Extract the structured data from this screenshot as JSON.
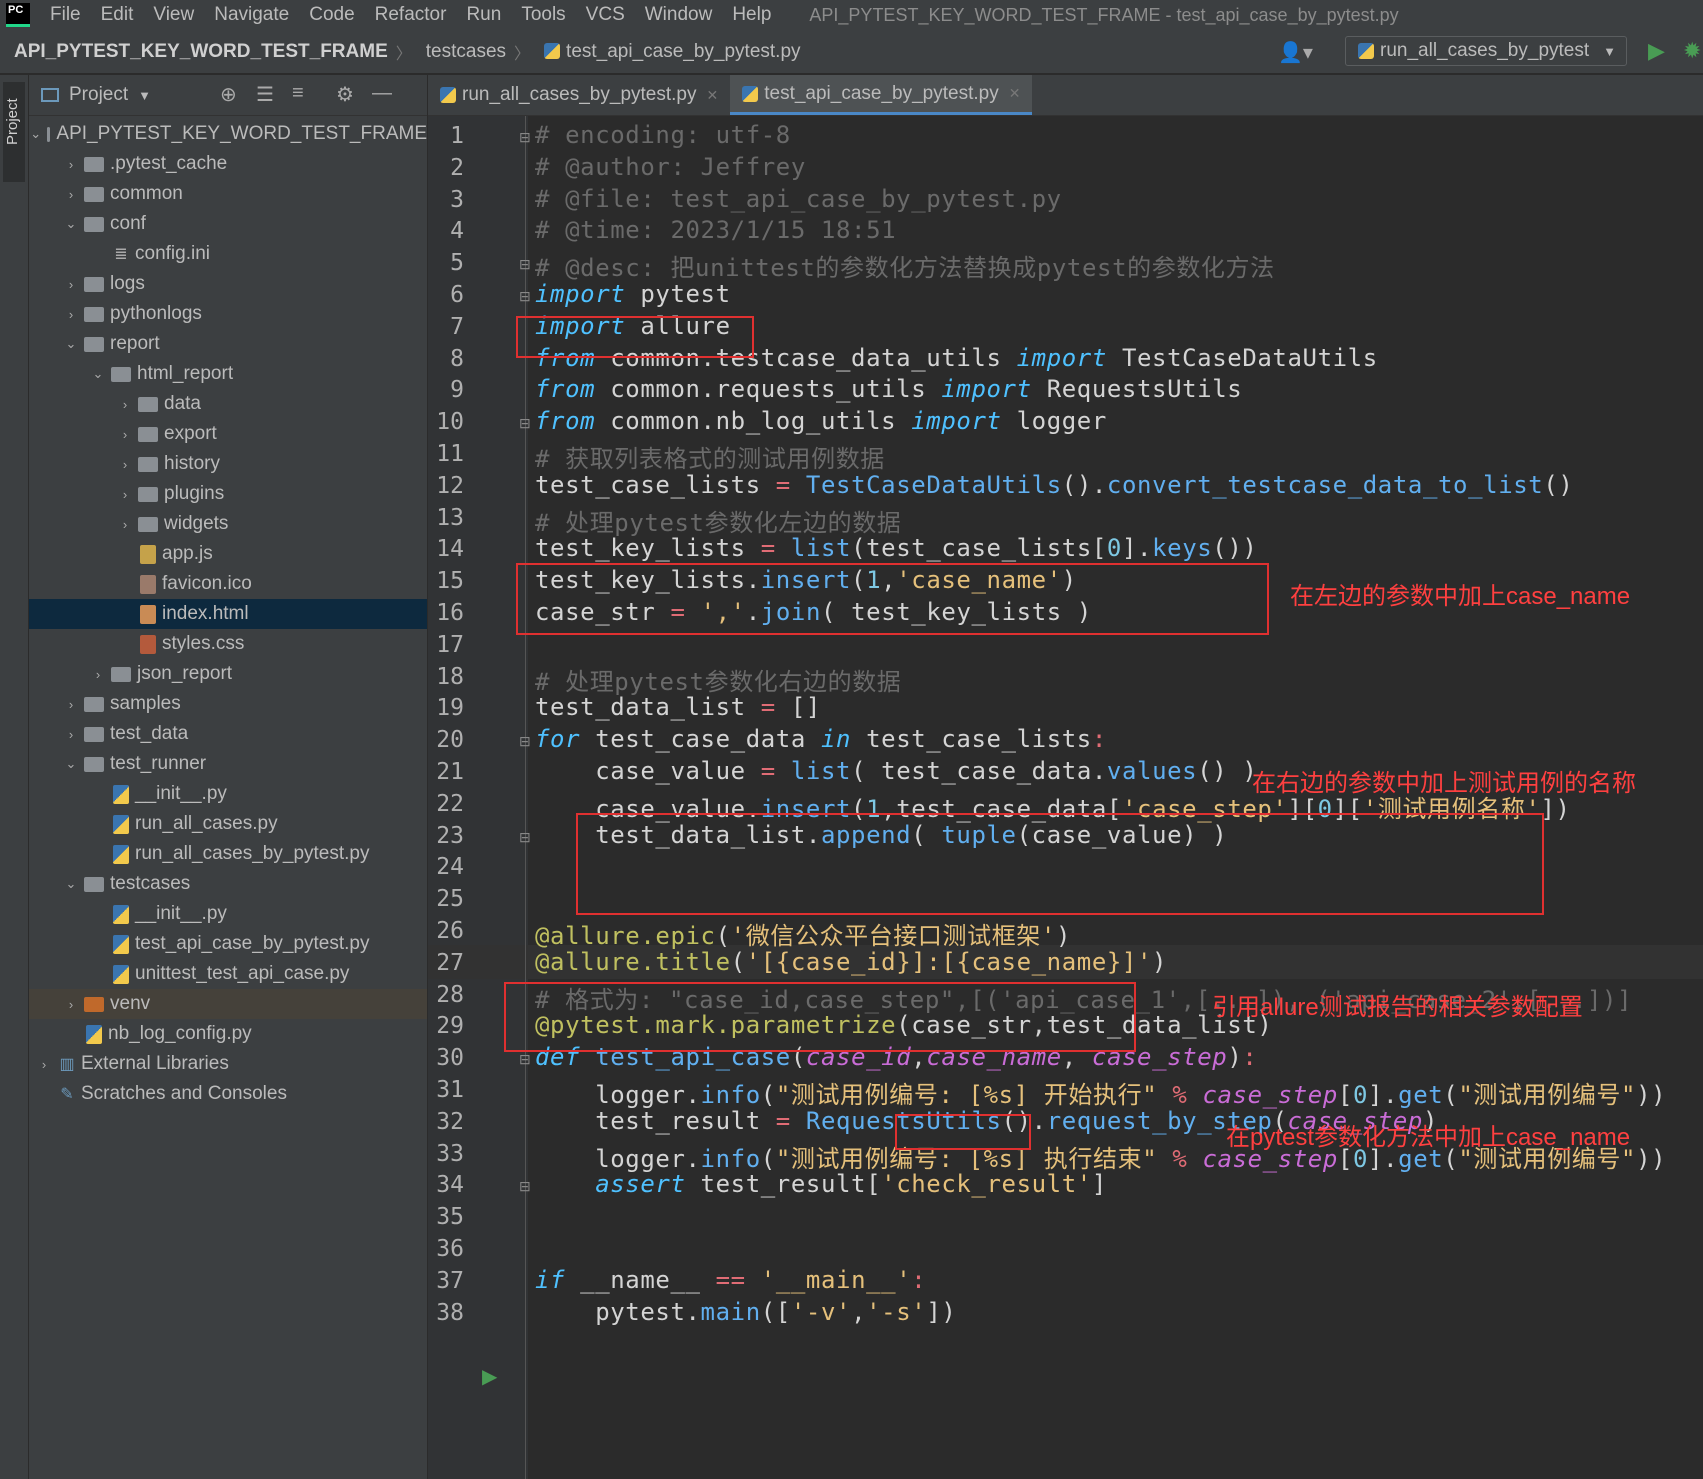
{
  "menu": {
    "items": [
      "File",
      "Edit",
      "View",
      "Navigate",
      "Code",
      "Refactor",
      "Run",
      "Tools",
      "VCS",
      "Window",
      "Help"
    ],
    "title": "API_PYTEST_KEY_WORD_TEST_FRAME - test_api_case_by_pytest.py",
    "logo": "PC"
  },
  "nav": {
    "crumbs": [
      "API_PYTEST_KEY_WORD_TEST_FRAME",
      "testcases",
      "test_api_case_by_pytest.py"
    ],
    "run_config": "run_all_cases_by_pytest"
  },
  "sidebar": {
    "stripe_label": "Project",
    "header": "Project",
    "tree": [
      {
        "label": "API_PYTEST_KEY_WORD_TEST_FRAME",
        "type": "folder",
        "depth": 0,
        "arrow": "v"
      },
      {
        "label": ".pytest_cache",
        "type": "folder",
        "depth": 1,
        "arrow": ">"
      },
      {
        "label": "common",
        "type": "folder",
        "depth": 1,
        "arrow": ">"
      },
      {
        "label": "conf",
        "type": "folder",
        "depth": 1,
        "arrow": "v"
      },
      {
        "label": "config.ini",
        "type": "ini",
        "depth": 2,
        "arrow": ""
      },
      {
        "label": "logs",
        "type": "folder",
        "depth": 1,
        "arrow": ">"
      },
      {
        "label": "pythonlogs",
        "type": "folder",
        "depth": 1,
        "arrow": ">"
      },
      {
        "label": "report",
        "type": "folder",
        "depth": 1,
        "arrow": "v"
      },
      {
        "label": "html_report",
        "type": "folder",
        "depth": 2,
        "arrow": "v"
      },
      {
        "label": "data",
        "type": "folder",
        "depth": 3,
        "arrow": ">"
      },
      {
        "label": "export",
        "type": "folder",
        "depth": 3,
        "arrow": ">"
      },
      {
        "label": "history",
        "type": "folder",
        "depth": 3,
        "arrow": ">"
      },
      {
        "label": "plugins",
        "type": "folder",
        "depth": 3,
        "arrow": ">"
      },
      {
        "label": "widgets",
        "type": "folder",
        "depth": 3,
        "arrow": ">"
      },
      {
        "label": "app.js",
        "type": "js",
        "depth": 3,
        "arrow": ""
      },
      {
        "label": "favicon.ico",
        "type": "ico",
        "depth": 3,
        "arrow": ""
      },
      {
        "label": "index.html",
        "type": "html",
        "depth": 3,
        "arrow": "",
        "selected": true
      },
      {
        "label": "styles.css",
        "type": "css",
        "depth": 3,
        "arrow": ""
      },
      {
        "label": "json_report",
        "type": "folder",
        "depth": 2,
        "arrow": ">"
      },
      {
        "label": "samples",
        "type": "folder",
        "depth": 1,
        "arrow": ">"
      },
      {
        "label": "test_data",
        "type": "folder",
        "depth": 1,
        "arrow": ">"
      },
      {
        "label": "test_runner",
        "type": "folder",
        "depth": 1,
        "arrow": "v"
      },
      {
        "label": "__init__.py",
        "type": "py",
        "depth": 2,
        "arrow": ""
      },
      {
        "label": "run_all_cases.py",
        "type": "py",
        "depth": 2,
        "arrow": ""
      },
      {
        "label": "run_all_cases_by_pytest.py",
        "type": "py",
        "depth": 2,
        "arrow": ""
      },
      {
        "label": "testcases",
        "type": "folder",
        "depth": 1,
        "arrow": "v"
      },
      {
        "label": "__init__.py",
        "type": "py",
        "depth": 2,
        "arrow": ""
      },
      {
        "label": "test_api_case_by_pytest.py",
        "type": "py",
        "depth": 2,
        "arrow": ""
      },
      {
        "label": "unittest_test_api_case.py",
        "type": "py",
        "depth": 2,
        "arrow": ""
      },
      {
        "label": "venv",
        "type": "venv",
        "depth": 1,
        "arrow": ">",
        "venv": true
      },
      {
        "label": "nb_log_config.py",
        "type": "py",
        "depth": 1,
        "arrow": ""
      },
      {
        "label": "External Libraries",
        "type": "lib",
        "depth": 0,
        "arrow": ">"
      },
      {
        "label": "Scratches and Consoles",
        "type": "scratch",
        "depth": 0,
        "arrow": ""
      }
    ]
  },
  "tabs": [
    {
      "label": "run_all_cases_by_pytest.py",
      "active": false
    },
    {
      "label": "test_api_case_by_pytest.py",
      "active": true
    }
  ],
  "code": {
    "current_line": 27,
    "lines": [
      [
        [
          "cm",
          "# encoding: utf-8"
        ]
      ],
      [
        [
          "cm",
          "# @author: Jeffrey"
        ]
      ],
      [
        [
          "cm",
          "# @file: test_api_case_by_pytest.py"
        ]
      ],
      [
        [
          "cm",
          "# @time: 2023/1/15 18:51"
        ]
      ],
      [
        [
          "cm",
          "# @desc: 把unittest的参数化方法替换成pytest的参数化方法"
        ]
      ],
      [
        [
          "kw",
          "import"
        ],
        [
          "nm",
          " pytest"
        ]
      ],
      [
        [
          "kw",
          "import"
        ],
        [
          "nm",
          " allure"
        ]
      ],
      [
        [
          "kw",
          "from"
        ],
        [
          "nm",
          " common.testcase_data_utils "
        ],
        [
          "kw",
          "import"
        ],
        [
          "nm",
          " TestCaseDataUtils"
        ]
      ],
      [
        [
          "kw",
          "from"
        ],
        [
          "nm",
          " common.requests_utils "
        ],
        [
          "kw",
          "import"
        ],
        [
          "nm",
          " RequestsUtils"
        ]
      ],
      [
        [
          "kw",
          "from"
        ],
        [
          "nm",
          " common.nb_log_utils "
        ],
        [
          "kw",
          "import"
        ],
        [
          "nm",
          " logger"
        ]
      ],
      [
        [
          "cm",
          "# 获取列表格式的测试用例数据"
        ]
      ],
      [
        [
          "nm",
          "test_case_lists "
        ],
        [
          "op",
          "="
        ],
        [
          "nm",
          " "
        ],
        [
          "cls",
          "TestCaseDataUtils"
        ],
        [
          "nm",
          "()."
        ],
        [
          "fn",
          "convert_testcase_data_to_list"
        ],
        [
          "nm",
          "()"
        ]
      ],
      [
        [
          "cm",
          "# 处理pytest参数化左边的数据"
        ]
      ],
      [
        [
          "nm",
          "test_key_lists "
        ],
        [
          "op",
          "="
        ],
        [
          "nm",
          " "
        ],
        [
          "fn",
          "list"
        ],
        [
          "nm",
          "(test_case_lists["
        ],
        [
          "num",
          "0"
        ],
        [
          "nm",
          "]."
        ],
        [
          "fn",
          "keys"
        ],
        [
          "nm",
          "())"
        ]
      ],
      [
        [
          "nm",
          "test_key_lists."
        ],
        [
          "fn",
          "insert"
        ],
        [
          "nm",
          "("
        ],
        [
          "num",
          "1"
        ],
        [
          "nm",
          ","
        ],
        [
          "st",
          "'case_name'"
        ],
        [
          "nm",
          ")"
        ]
      ],
      [
        [
          "nm",
          "case_str "
        ],
        [
          "op",
          "="
        ],
        [
          "nm",
          " "
        ],
        [
          "st",
          "','"
        ],
        [
          "nm",
          "."
        ],
        [
          "fn",
          "join"
        ],
        [
          "nm",
          "( test_key_lists )"
        ]
      ],
      [],
      [
        [
          "cm",
          "# 处理pytest参数化右边的数据"
        ]
      ],
      [
        [
          "nm",
          "test_data_list "
        ],
        [
          "op",
          "="
        ],
        [
          "nm",
          " []"
        ]
      ],
      [
        [
          "kw",
          "for"
        ],
        [
          "nm",
          " test_case_data "
        ],
        [
          "kw",
          "in"
        ],
        [
          "nm",
          " test_case_lists"
        ],
        [
          "op",
          ":"
        ]
      ],
      [
        [
          "nm",
          "    case_value "
        ],
        [
          "op",
          "="
        ],
        [
          "nm",
          " "
        ],
        [
          "fn",
          "list"
        ],
        [
          "nm",
          "( test_case_data."
        ],
        [
          "fn",
          "values"
        ],
        [
          "nm",
          "() )"
        ]
      ],
      [
        [
          "nm",
          "    case_value."
        ],
        [
          "fn",
          "insert"
        ],
        [
          "nm",
          "("
        ],
        [
          "num",
          "1"
        ],
        [
          "nm",
          ",test_case_data["
        ],
        [
          "st",
          "'case_step'"
        ],
        [
          "nm",
          "]["
        ],
        [
          "num",
          "0"
        ],
        [
          "nm",
          "]["
        ],
        [
          "st",
          "'测试用例名称'"
        ],
        [
          "nm",
          "])"
        ]
      ],
      [
        [
          "nm",
          "    test_data_list."
        ],
        [
          "fn",
          "append"
        ],
        [
          "nm",
          "( "
        ],
        [
          "fn",
          "tuple"
        ],
        [
          "nm",
          "(case_value) )"
        ]
      ],
      [],
      [],
      [
        [
          "dec",
          "@allure.epic"
        ],
        [
          "nm",
          "("
        ],
        [
          "st",
          "'微信公众平台接口测试框架'"
        ],
        [
          "nm",
          ")"
        ]
      ],
      [
        [
          "dec",
          "@allure.title"
        ],
        [
          "nm",
          "("
        ],
        [
          "st",
          "'[{case_id}]:[{case_name}]'"
        ],
        [
          "nm",
          ")"
        ]
      ],
      [
        [
          "cm",
          "# 格式为: \"case_id,case_step\",[('api_case_1',[...]), ('api_case_2',[...])]"
        ]
      ],
      [
        [
          "dec",
          "@pytest.mark.parametrize"
        ],
        [
          "nm",
          "(case_str,test_data_list)"
        ]
      ],
      [
        [
          "kw",
          "def"
        ],
        [
          "nm",
          " "
        ],
        [
          "fn",
          "test_api_case"
        ],
        [
          "nm",
          "("
        ],
        [
          "par",
          "case_id"
        ],
        [
          "nm",
          ","
        ],
        [
          "par",
          "case_name"
        ],
        [
          "nm",
          ", "
        ],
        [
          "par",
          "case_step"
        ],
        [
          "nm",
          ")"
        ],
        [
          "op",
          ":"
        ]
      ],
      [
        [
          "nm",
          "    logger."
        ],
        [
          "fn",
          "info"
        ],
        [
          "nm",
          "("
        ],
        [
          "st",
          "\"测试用例编号: [%s] 开始执行\""
        ],
        [
          "nm",
          " "
        ],
        [
          "op",
          "%"
        ],
        [
          "nm",
          " "
        ],
        [
          "par",
          "case_step"
        ],
        [
          "nm",
          "["
        ],
        [
          "num",
          "0"
        ],
        [
          "nm",
          "]."
        ],
        [
          "fn",
          "get"
        ],
        [
          "nm",
          "("
        ],
        [
          "st",
          "\"测试用例编号\""
        ],
        [
          "nm",
          "))"
        ]
      ],
      [
        [
          "nm",
          "    test_result "
        ],
        [
          "op",
          "="
        ],
        [
          "nm",
          " "
        ],
        [
          "cls",
          "RequestsUtils"
        ],
        [
          "nm",
          "()."
        ],
        [
          "fn",
          "request_by_step"
        ],
        [
          "nm",
          "("
        ],
        [
          "par",
          "case_step"
        ],
        [
          "nm",
          ")"
        ]
      ],
      [
        [
          "nm",
          "    logger."
        ],
        [
          "fn",
          "info"
        ],
        [
          "nm",
          "("
        ],
        [
          "st",
          "\"测试用例编号: [%s] 执行结束\""
        ],
        [
          "nm",
          " "
        ],
        [
          "op",
          "%"
        ],
        [
          "nm",
          " "
        ],
        [
          "par",
          "case_step"
        ],
        [
          "nm",
          "["
        ],
        [
          "num",
          "0"
        ],
        [
          "nm",
          "]."
        ],
        [
          "fn",
          "get"
        ],
        [
          "nm",
          "("
        ],
        [
          "st",
          "\"测试用例编号\""
        ],
        [
          "nm",
          "))"
        ]
      ],
      [
        [
          "nm",
          "    "
        ],
        [
          "kw",
          "assert"
        ],
        [
          "nm",
          " test_result["
        ],
        [
          "st",
          "'check_result'"
        ],
        [
          "nm",
          "]"
        ]
      ],
      [],
      [],
      [
        [
          "kw",
          "if"
        ],
        [
          "nm",
          " __name__ "
        ],
        [
          "op",
          "=="
        ],
        [
          "nm",
          " "
        ],
        [
          "st",
          "'__main__'"
        ],
        [
          "op",
          ":"
        ]
      ],
      [
        [
          "nm",
          "    pytest."
        ],
        [
          "fn",
          "main"
        ],
        [
          "nm",
          "(["
        ],
        [
          "st",
          "'-v'"
        ],
        [
          "nm",
          ","
        ],
        [
          "st",
          "'-s'"
        ],
        [
          "nm",
          "])"
        ]
      ]
    ]
  },
  "annotations": {
    "a1": "在左边的参数中加上case_name",
    "a2": "在右边的参数中加上测试用例的名称",
    "a3": "引用allure测试报告的相关参数配置",
    "a4": "在pytest参数化方法中加上case_name"
  }
}
